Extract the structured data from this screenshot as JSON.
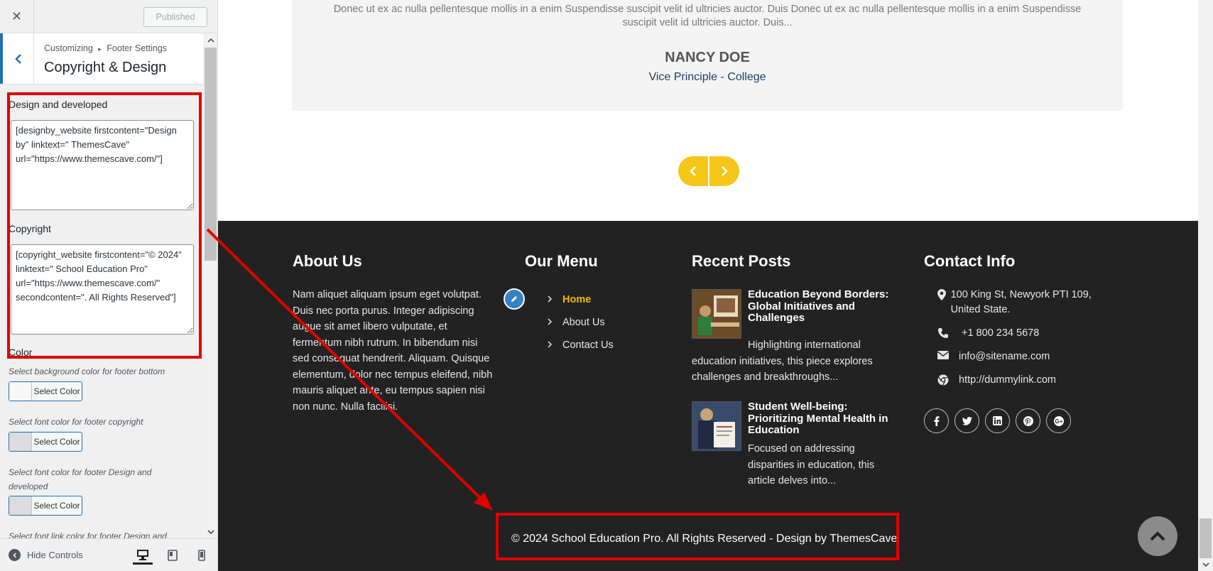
{
  "customizer": {
    "close_label": "✕",
    "published_label": "Published",
    "breadcrumb": [
      "Customizing",
      "▸",
      "Footer Settings"
    ],
    "section_title": "Copyright & Design",
    "design_label": "Design and developed",
    "design_value": "[designby_website firstcontent=\"Design by\" linktext=\" ThemesCave\" url=\"https://www.themescave.com/\"]",
    "copyright_label": "Copyright",
    "copyright_value": "[copyright_website firstcontent=\"© 2024\" linktext=\" School Education Pro\" url=\"https://www.themescave.com/\" secondcontent=\". All Rights Reserved\"]",
    "color_label": "Color",
    "color_controls": [
      {
        "description": "Select background color for footer bottom",
        "button": "Select Color"
      },
      {
        "description": "Select font color for footer copyright",
        "button": "Select Color"
      },
      {
        "description": "Select font color for footer Design and developed",
        "button": "Select Color"
      }
    ],
    "partial_description": "Select font link color for footer Design and",
    "hide_controls_label": "Hide Controls",
    "device_icons": [
      "desktop-icon",
      "tablet-icon",
      "mobile-icon"
    ]
  },
  "testimonial": {
    "quote": "Donec ut ex ac nulla pellentesque mollis in a enim Suspendisse suscipit velit id ultricies auctor. Duis Donec ut ex ac nulla pellentesque mollis in a enim Suspendisse suscipit velit id ultricies auctor. Duis...",
    "name": "NANCY DOE",
    "role": "Vice Principle - College"
  },
  "footer": {
    "about_heading": "About Us",
    "about_text": "Nam aliquet aliquam ipsum eget volutpat. Duis nec porta purus. Integer adipiscing augue sit amet libero vulputate, et fermentum nibh rutrum. In bibendum nisi sed consequat hendrerit. Aliquam. Quisque elementum, dolor nec tempus eleifend, nibh mauris aliquet ante, eu tempus sapien nisi non nunc. Nulla facilisi.",
    "menu_heading": "Our Menu",
    "menu_items": [
      "Home",
      "About Us",
      "Contact Us"
    ],
    "posts_heading": "Recent Posts",
    "posts": [
      {
        "title": "Education Beyond Borders: Global Initiatives and Challenges",
        "excerpt": "Highlighting international education initiatives, this piece explores challenges and breakthroughs..."
      },
      {
        "title": "Student Well-being: Prioritizing Mental Health in Education",
        "excerpt": "Focused on addressing disparities in education, this article delves into..."
      }
    ],
    "contact_heading": "Contact Info",
    "address": "100 King St, Newyork PTI 109, United State.",
    "phone": "+1 800 234 5678",
    "email": "info@sitename.com",
    "website": "http://dummylink.com",
    "socials": [
      "facebook-icon",
      "twitter-icon",
      "linkedin-icon",
      "pinterest-icon",
      "google-plus-icon"
    ],
    "copyright": {
      "first": "© 2024",
      "link": " School Education Pro",
      "second": ". All Rights Reserved",
      "sep": " - ",
      "design_first": "Design by",
      "design_link": " ThemesCave"
    }
  },
  "colors": {
    "accent_yellow": "#f5c518",
    "highlight_red": "#e00000",
    "footer_bg": "#222222",
    "wp_blue": "#2271b1"
  }
}
